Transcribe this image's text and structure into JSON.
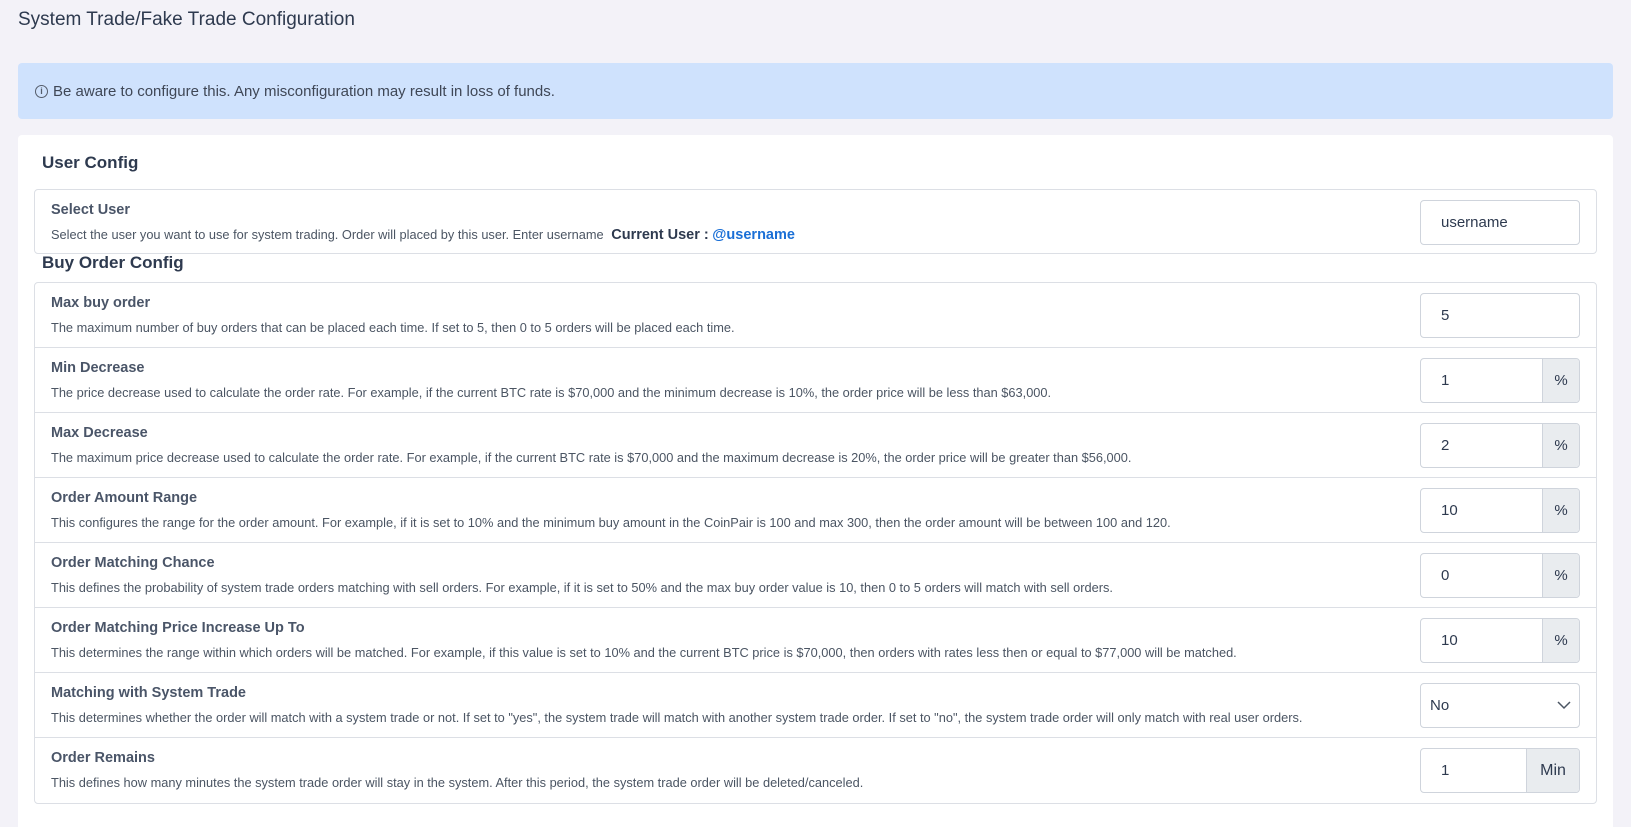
{
  "page": {
    "title": "System Trade/Fake Trade Configuration"
  },
  "alert": {
    "icon": "info-circle-icon",
    "text": "Be aware to configure this. Any misconfiguration may result in loss of funds."
  },
  "user_config": {
    "title": "User Config",
    "select_user": {
      "label": "Select User",
      "description": "Select the user you want to use for system trading. Order will placed by this user. Enter username",
      "current_user_label": "Current User :",
      "current_user_value": "@username",
      "input_value": "username"
    }
  },
  "buy_order_config": {
    "title": "Buy Order Config",
    "rows": [
      {
        "label": "Max buy order",
        "description": "The maximum number of buy orders that can be placed each time. If set to 5, then 0 to 5 orders will be placed each time.",
        "value": "5",
        "addon": ""
      },
      {
        "label": "Min Decrease",
        "description": "The price decrease used to calculate the order rate. For example, if the current BTC rate is $70,000 and the minimum decrease is 10%, the order price will be less than $63,000.",
        "value": "1",
        "addon": "%"
      },
      {
        "label": "Max Decrease",
        "description": "The maximum price decrease used to calculate the order rate. For example, if the current BTC rate is $70,000 and the maximum decrease is 20%, the order price will be greater than $56,000.",
        "value": "2",
        "addon": "%"
      },
      {
        "label": "Order Amount Range",
        "description": "This configures the range for the order amount. For example, if it is set to 10% and the minimum buy amount in the CoinPair is 100 and max 300, then the order amount will be between 100 and 120.",
        "value": "10",
        "addon": "%"
      },
      {
        "label": "Order Matching Chance",
        "description": "This defines the probability of system trade orders matching with sell orders. For example, if it is set to 50% and the max buy order value is 10, then 0 to 5 orders will match with sell orders.",
        "value": "0",
        "addon": "%"
      },
      {
        "label": "Order Matching Price Increase Up To",
        "description": "This determines the range within which orders will be matched. For example, if this value is set to 10% and the current BTC price is $70,000, then orders with rates less then or equal to $77,000 will be matched.",
        "value": "10",
        "addon": "%"
      },
      {
        "label": "Matching with System Trade",
        "description": "This determines whether the order will match with a system trade or not. If set to \"yes\", the system trade will match with another system trade order. If set to \"no\", the system trade order will only match with real user orders.",
        "selected": "No"
      },
      {
        "label": "Order Remains",
        "description": "This defines how many minutes the system trade order will stay in the system. After this period, the system trade order will be deleted/canceled.",
        "value": "1",
        "addon": "Min"
      }
    ]
  }
}
